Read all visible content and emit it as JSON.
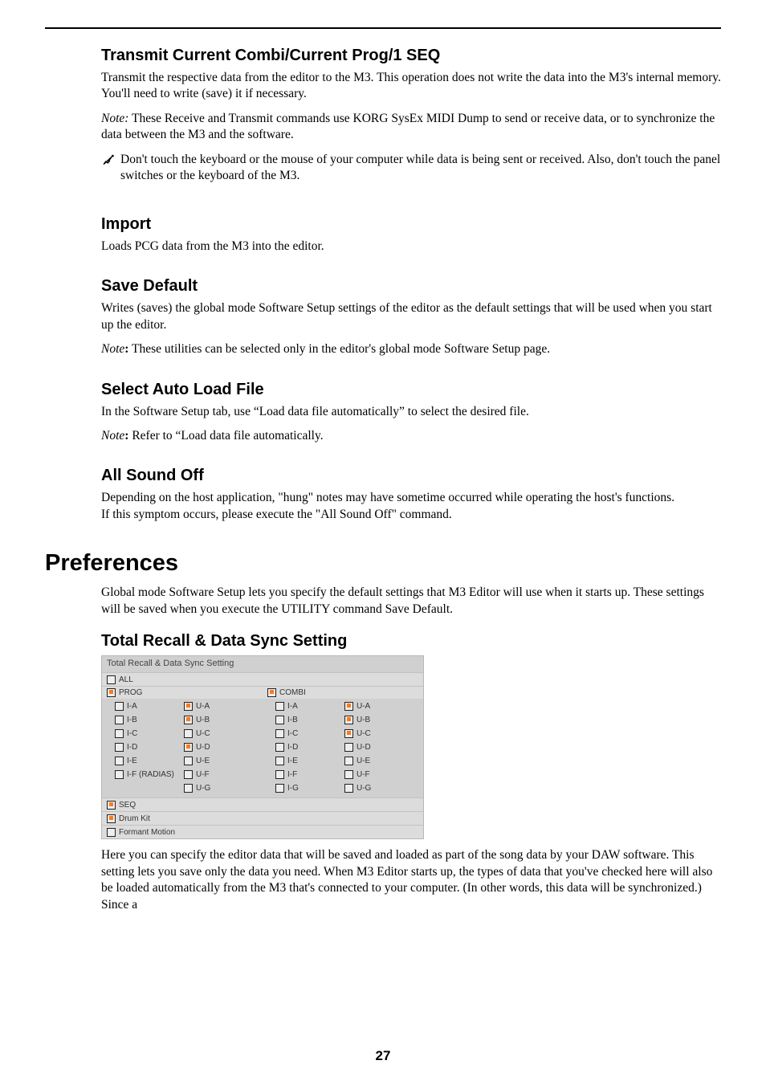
{
  "page_number": "27",
  "sections": {
    "transmit": {
      "title": "Transmit Current Combi/Current Prog/1 SEQ",
      "p1": "Transmit the respective data from the editor to the M3.  This operation does not write the data into the M3's internal memory. You'll need to write (save) it if necessary.",
      "note_label": "Note:",
      "note_text": " These Receive and Transmit commands use KORG SysEx MIDI Dump to send or receive data, or to synchronize the data between the M3 and the software.",
      "warn": "Don't touch the keyboard or the mouse of your computer while data is being sent or received. Also, don't touch the panel switches or the keyboard of the M3."
    },
    "import": {
      "title": "Import",
      "p1": "Loads PCG data from the M3 into the editor."
    },
    "save_default": {
      "title": "Save Default",
      "p1": "Writes (saves) the global mode Software Setup settings of the editor as the default settings that will be used when you start up the editor.",
      "note_label": "Note",
      "note_text": ": These utilities can be selected only in the editor's global mode Software Setup page."
    },
    "select_auto": {
      "title": "Select Auto Load File",
      "p1": "In the Software Setup tab, use “Load data file automatically” to select the desired file.",
      "note_label": "Note",
      "note_text": ": Refer to “Load data file automatically."
    },
    "all_sound_off": {
      "title": "All Sound Off",
      "p1": "Depending on the host application, \"hung\" notes may have sometime occurred while operating the host's functions.",
      "p2": "If this symptom occurs, please execute the \"All Sound Off\" command."
    }
  },
  "preferences": {
    "title": "Preferences",
    "intro": "Global mode Software Setup lets you specify the default settings that M3 Editor will use when it starts up. These settings will be saved when you execute the UTILITY command Save Default.",
    "total_recall_title": "Total Recall & Data Sync Setting",
    "after_text": "Here you can specify the editor data that will be saved and loaded as part of the song data by your DAW software. This setting lets you save only the data you need. When M3 Editor starts up, the types of data that you've checked here will also be loaded automatically from the M3 that's connected to your computer. (In other words, this data will be synchronized.) Since a"
  },
  "figure": {
    "title": "Total Recall & Data Sync Setting",
    "all": {
      "label": "ALL",
      "checked": false
    },
    "prog": {
      "label": "PROG",
      "checked": true,
      "rows": [
        {
          "l": {
            "label": "I-A",
            "checked": false
          },
          "r": {
            "label": "U-A",
            "checked": true
          }
        },
        {
          "l": {
            "label": "I-B",
            "checked": false
          },
          "r": {
            "label": "U-B",
            "checked": true
          }
        },
        {
          "l": {
            "label": "I-C",
            "checked": false
          },
          "r": {
            "label": "U-C",
            "checked": false
          }
        },
        {
          "l": {
            "label": "I-D",
            "checked": false
          },
          "r": {
            "label": "U-D",
            "checked": true
          }
        },
        {
          "l": {
            "label": "I-E",
            "checked": false
          },
          "r": {
            "label": "U-E",
            "checked": false
          }
        },
        {
          "l": {
            "label": "I-F (RADIAS)",
            "checked": false
          },
          "r": {
            "label": "U-F",
            "checked": false
          }
        },
        {
          "l": null,
          "r": {
            "label": "U-G",
            "checked": false
          }
        }
      ]
    },
    "combi": {
      "label": "COMBI",
      "checked": true,
      "rows": [
        {
          "l": {
            "label": "I-A",
            "checked": false
          },
          "r": {
            "label": "U-A",
            "checked": true
          }
        },
        {
          "l": {
            "label": "I-B",
            "checked": false
          },
          "r": {
            "label": "U-B",
            "checked": true
          }
        },
        {
          "l": {
            "label": "I-C",
            "checked": false
          },
          "r": {
            "label": "U-C",
            "checked": true
          }
        },
        {
          "l": {
            "label": "I-D",
            "checked": false
          },
          "r": {
            "label": "U-D",
            "checked": false
          }
        },
        {
          "l": {
            "label": "I-E",
            "checked": false
          },
          "r": {
            "label": "U-E",
            "checked": false
          }
        },
        {
          "l": {
            "label": "I-F",
            "checked": false
          },
          "r": {
            "label": "U-F",
            "checked": false
          }
        },
        {
          "l": {
            "label": "I-G",
            "checked": false
          },
          "r": {
            "label": "U-G",
            "checked": false
          }
        }
      ]
    },
    "seq": {
      "label": "SEQ",
      "checked": true
    },
    "drumkit": {
      "label": "Drum Kit",
      "checked": true
    },
    "formant": {
      "label": "Formant Motion",
      "checked": false
    }
  }
}
